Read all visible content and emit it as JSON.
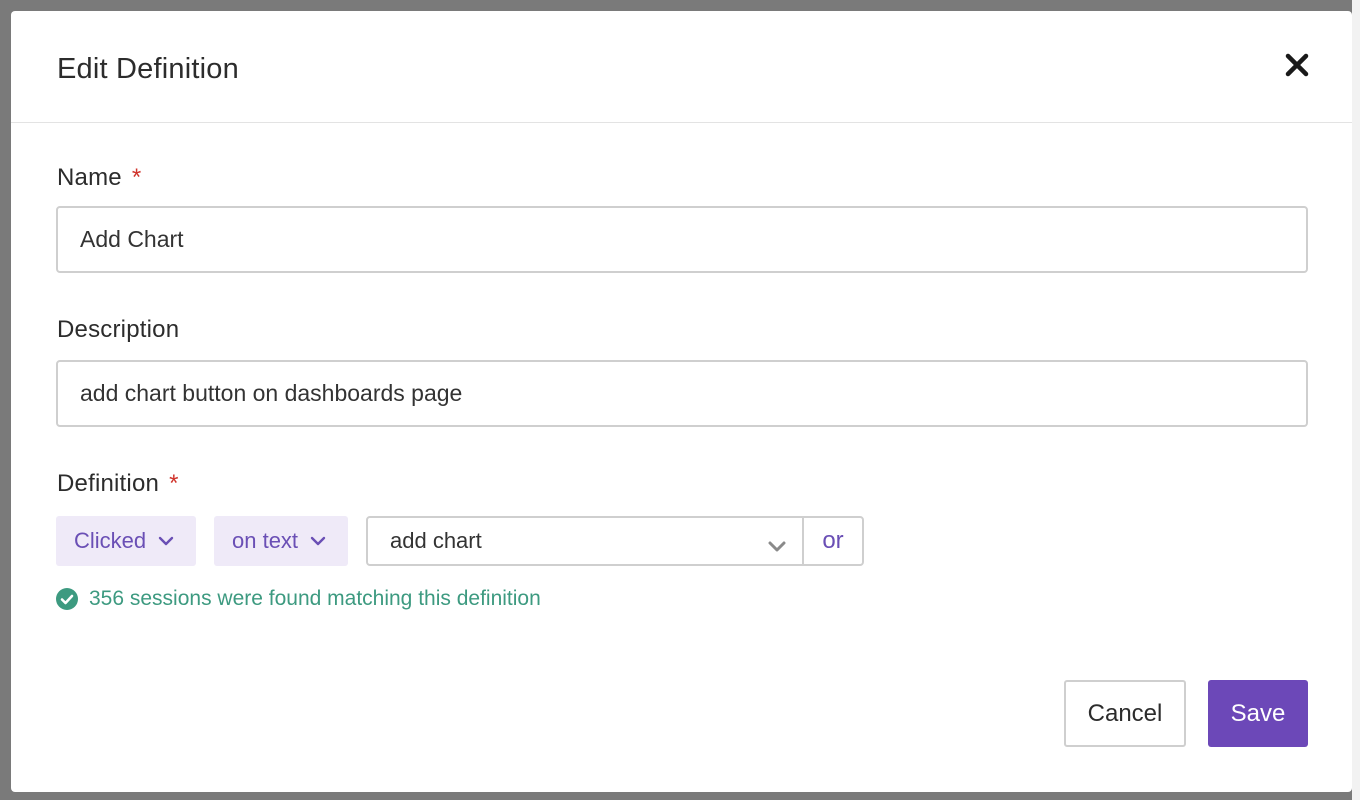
{
  "modal": {
    "title": "Edit Definition",
    "close_icon": "close-icon"
  },
  "name_field": {
    "label": "Name",
    "required_marker": "*",
    "value": "Add Chart"
  },
  "description_field": {
    "label": "Description",
    "value": "add chart button on dashboards page"
  },
  "definition_field": {
    "label": "Definition",
    "required_marker": "*",
    "event_type": "Clicked",
    "match_mode": "on text",
    "match_value": "add chart",
    "or_label": "or"
  },
  "status": {
    "icon": "check-circle-icon",
    "text": "356 sessions were found matching this definition"
  },
  "actions": {
    "cancel_label": "Cancel",
    "save_label": "Save"
  },
  "colors": {
    "accent": "#6c48b8",
    "pill_bg": "#efeaf8",
    "success": "#3d9a80",
    "required": "#d0342c"
  }
}
